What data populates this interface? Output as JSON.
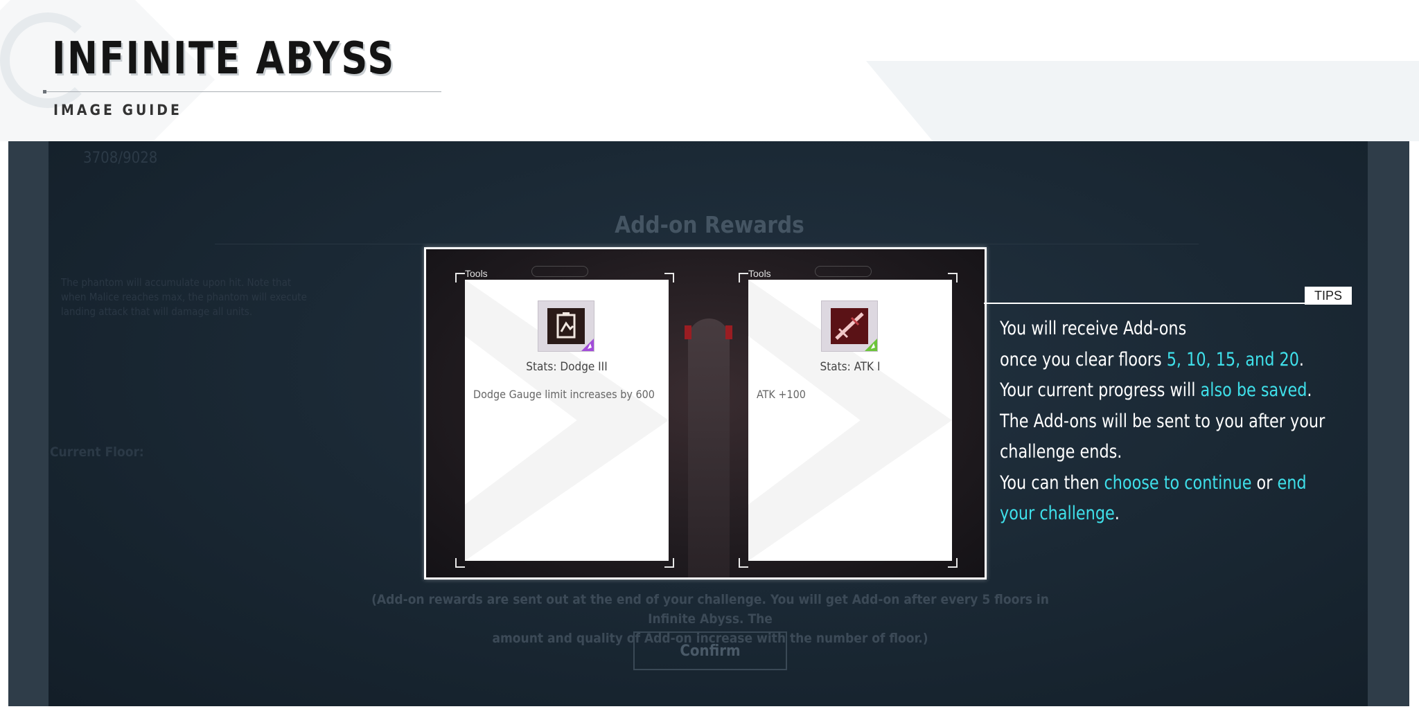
{
  "header": {
    "title": "INFINITE ABYSS",
    "subtitle": "IMAGE GUIDE"
  },
  "background": {
    "stat_value": "3708/9028",
    "boss_text": "The phantom will accumulate upon hit. Note that when Malice reaches max, the phantom will execute landing attack that will damage all units.",
    "current_floor_label": "Current Floor:",
    "rewards_title": "Add-on Rewards",
    "note_line1": "(Add-on rewards are sent out at the end of your challenge. You will get Add-on after every 5 floors in Infinite Abyss. The",
    "note_line2": "amount and quality of Add-on increase with the number of floor.)",
    "confirm_label": "Confirm"
  },
  "cards": [
    {
      "category": "Tools",
      "name": "Stats: Dodge III",
      "description": "Dodge Gauge limit increases by 600",
      "icon": "dodge-icon",
      "badge_color": "#a24cd9"
    },
    {
      "category": "Tools",
      "name": "Stats: ATK I",
      "description": "ATK +100",
      "icon": "atk-icon",
      "badge_color": "#6cc43a"
    }
  ],
  "tips": {
    "tag": "TIPS",
    "line1": "You will receive Add-ons",
    "line2_pre": "once you clear floors ",
    "line2_hl": "5, 10, 15, and 20",
    "line2_post": ".",
    "line3_pre": "Your current progress will ",
    "line3_hl": "also be saved",
    "line3_post": ".",
    "line4": "The Add-ons will be sent to you after your",
    "line5": "challenge ends.",
    "line6_pre": "You can then ",
    "line6_hl1": "choose to continue",
    "line6_mid": " or ",
    "line6_hl2": "end",
    "line7_hl": "your challenge",
    "line7_post": ".",
    "highlight_color": "#3fe0ea"
  }
}
